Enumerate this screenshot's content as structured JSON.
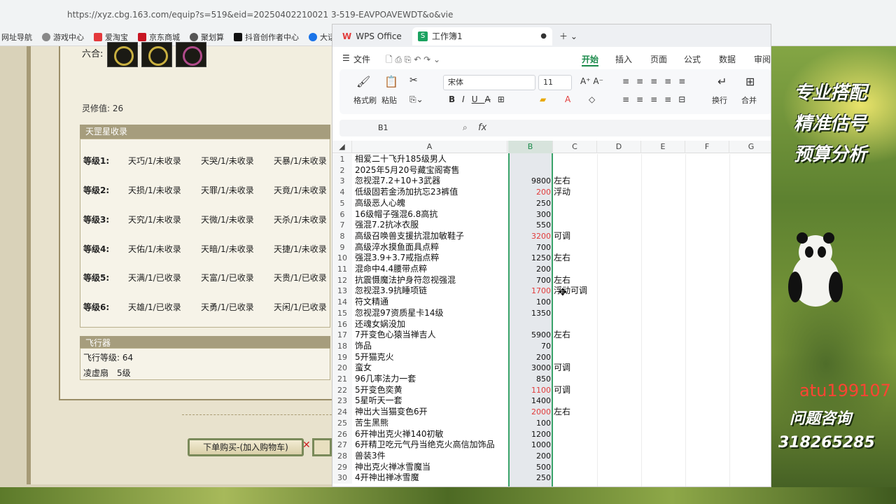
{
  "browser": {
    "url": "https://xyz.cbg.163.com/equip?s=519&eid=20250402210021 3-519-EAVPOAVEWDT&o&vie",
    "bookmarks": [
      "网址导航",
      "游戏中心",
      "爱淘宝",
      "京东商城",
      "聚划算",
      "抖音创作者中心",
      "大话端游"
    ]
  },
  "game": {
    "six_label": "六合:",
    "lingxiu": "灵修值: 26",
    "tiangang_title": "天罡星收录",
    "tiangang_rows": [
      {
        "level": "等级1:",
        "c1": "天巧/1/未收录",
        "c2": "天哭/1/未收录",
        "c3": "天暴/1/未收录"
      },
      {
        "level": "等级2:",
        "c1": "天损/1/未收录",
        "c2": "天罪/1/未收录",
        "c3": "天竟/1/未收录"
      },
      {
        "level": "等级3:",
        "c1": "天究/1/未收录",
        "c2": "天微/1/未收录",
        "c3": "天杀/1/未收录"
      },
      {
        "level": "等级4:",
        "c1": "天佑/1/未收录",
        "c2": "天暗/1/未收录",
        "c3": "天捷/1/未收录"
      },
      {
        "level": "等级5:",
        "c1": "天满/1/已收录",
        "c2": "天富/1/已收录",
        "c3": "天贵/1/已收录"
      },
      {
        "level": "等级6:",
        "c1": "天雄/1/已收录",
        "c2": "天勇/1/已收录",
        "c3": "天闲/1/已收录"
      }
    ],
    "feixing_title": "飞行器",
    "feixing_level": "飞行等级: 64",
    "lingyun": "凌虚扇",
    "lingyun_level": "5级",
    "buy_button": "下单购买-(加入购物车)"
  },
  "wps": {
    "app_tab": "WPS Office",
    "doc_tab": "工作簿1",
    "file_menu": "文件",
    "menu": [
      "开始",
      "插入",
      "页面",
      "公式",
      "数据",
      "审阅"
    ],
    "ribbon": {
      "format_painter": "格式刷",
      "paste": "粘贴",
      "font": "宋体",
      "size": "11",
      "wrap": "换行",
      "merge": "合并"
    },
    "namebox": "B1",
    "fx": "fx",
    "columns": [
      "A",
      "B",
      "C",
      "D",
      "E",
      "F",
      "G"
    ],
    "rows": [
      {
        "n": "1",
        "a": "相爱二十飞升185级男人",
        "b": "",
        "c": ""
      },
      {
        "n": "2",
        "a": "2025年5月20号藏宝阁寄售",
        "b": "",
        "c": ""
      },
      {
        "n": "3",
        "a": "忽视混7.2+10+3武器",
        "b": "9800",
        "c": "左右"
      },
      {
        "n": "4",
        "a": "低级固若金汤加抗忘23裤值",
        "b": "200",
        "c": "浮动",
        "red": true
      },
      {
        "n": "5",
        "a": "高级恶人心魄",
        "b": "250",
        "c": ""
      },
      {
        "n": "6",
        "a": "16级帽子强混6.8高抗",
        "b": "300",
        "c": ""
      },
      {
        "n": "7",
        "a": "强混7.2抗冰衣服",
        "b": "550",
        "c": ""
      },
      {
        "n": "8",
        "a": "高级召唤兽支援抗混加敏鞋子",
        "b": "3200",
        "c": "可调",
        "red": true
      },
      {
        "n": "9",
        "a": "高级淬水摸鱼面具点粹",
        "b": "700",
        "c": ""
      },
      {
        "n": "10",
        "a": "强混3.9+3.7戒指点粹",
        "b": "1250",
        "c": "左右"
      },
      {
        "n": "11",
        "a": "混命中4.4腰带点粹",
        "b": "200",
        "c": ""
      },
      {
        "n": "12",
        "a": "抗震慑魔法护身符忽视强混",
        "b": "700",
        "c": "左右"
      },
      {
        "n": "13",
        "a": "忽视混3.9抗睡项链",
        "b": "1700",
        "c": "浮动可调",
        "red": true
      },
      {
        "n": "14",
        "a": "符文精通",
        "b": "100",
        "c": ""
      },
      {
        "n": "15",
        "a": "忽视混97资质星卡14级",
        "b": "1350",
        "c": ""
      },
      {
        "n": "16",
        "a": "还魂女娲没加",
        "b": "",
        "c": ""
      },
      {
        "n": "17",
        "a": "7开变色心猿当禅吉人",
        "b": "5900",
        "c": "左右"
      },
      {
        "n": "18",
        "a": "饰品",
        "b": "70",
        "c": ""
      },
      {
        "n": "19",
        "a": "5开猫克火",
        "b": "200",
        "c": ""
      },
      {
        "n": "20",
        "a": "蛮女",
        "b": "3000",
        "c": "可调"
      },
      {
        "n": "21",
        "a": "96几率法力一套",
        "b": "850",
        "c": ""
      },
      {
        "n": "22",
        "a": "5开变色奕黄",
        "b": "1100",
        "c": "可调",
        "red": true
      },
      {
        "n": "23",
        "a": "5星听天一套",
        "b": "1400",
        "c": ""
      },
      {
        "n": "24",
        "a": "神出大当猫变色6开",
        "b": "2000",
        "c": "左右",
        "red": true
      },
      {
        "n": "25",
        "a": "苦生黑熊",
        "b": "100",
        "c": ""
      },
      {
        "n": "26",
        "a": "6开神出克火禅140初敏",
        "b": "1200",
        "c": ""
      },
      {
        "n": "27",
        "a": "6开精卫吃元气丹当绝克火高信加饰品",
        "b": "1000",
        "c": ""
      },
      {
        "n": "28",
        "a": "兽装3件",
        "b": "200",
        "c": ""
      },
      {
        "n": "29",
        "a": "神出克火禅冰雪魔当",
        "b": "500",
        "c": ""
      },
      {
        "n": "30",
        "a": "4开神出禅冰雪魔",
        "b": "250",
        "c": ""
      }
    ]
  },
  "overlay": {
    "promo1": "专业搭配",
    "promo2": "精准估号",
    "promo3": "预算分析",
    "contact_id": "atu199107",
    "contact_label": "问题咨询",
    "contact_num": "318265285"
  }
}
